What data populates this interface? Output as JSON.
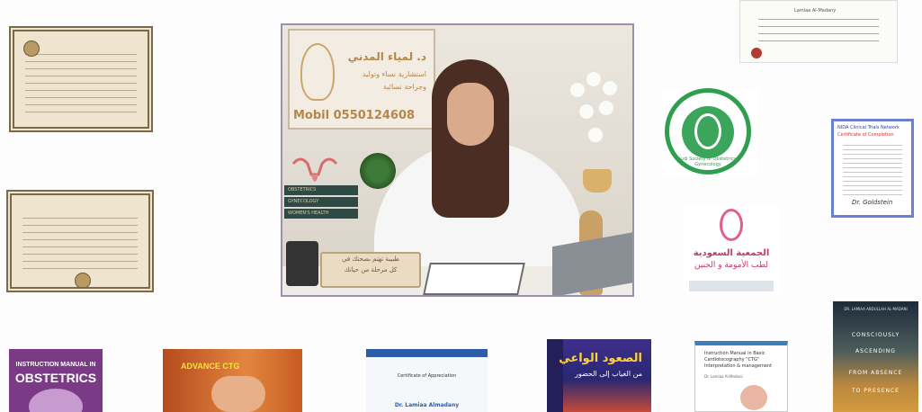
{
  "photo": {
    "sign_name": "د. لمياء المدني",
    "sign_line1": "استشارية نساء وتوليد",
    "sign_line2": "وجراحة نسائية",
    "sign_mobile": "Mobil 0550124608",
    "books_shelf": [
      "OBSTETRICS",
      "GYNECOLOGY",
      "WOMEN'S HEALTH"
    ],
    "plaque_line1": "طبيبة تهتم بصحتك في",
    "plaque_line2": "كل مرحلة من حياتك"
  },
  "logos": {
    "sbog_text": "Saudi Society of Obstetrics & Gynecology",
    "sspm_line1": "الجمعية السعودية",
    "sspm_line2": "لطب الأمومة و الجنين"
  },
  "certificates": {
    "nida_title": "NIDA Clinical Trials Network",
    "nida_subtitle": "Certificate of Completion",
    "nida_signature": "Dr. Goldstein",
    "top_right_name": "Lamiaa Al-Madany"
  },
  "books": {
    "book1_line1": "INSTRUCTION MANUAL IN",
    "book1_line2": "OBSTETRICS",
    "book2_title": "ADVANCE CTG",
    "book3_title": "Certificate of Appreciation",
    "book3_author": "Dr. Lamiaa Almadany",
    "book4_title": "الصعود الواعي",
    "book4_subtitle": "من الغياب إلى الحضور",
    "book5_title": "Instruction Manual in Basic Cardiotocography \"CTG\" Interpretation & management",
    "book5_author": "Dr. Lamiaa Al-Madani",
    "book6_author": "DR. LAMIAA ABDULLAH AL-MADANI",
    "book6_line1": "CONSCIOUSLY",
    "book6_line2": "ASCENDING",
    "book6_line3": "FROM ABSENCE",
    "book6_line4": "TO PRESENCE"
  }
}
